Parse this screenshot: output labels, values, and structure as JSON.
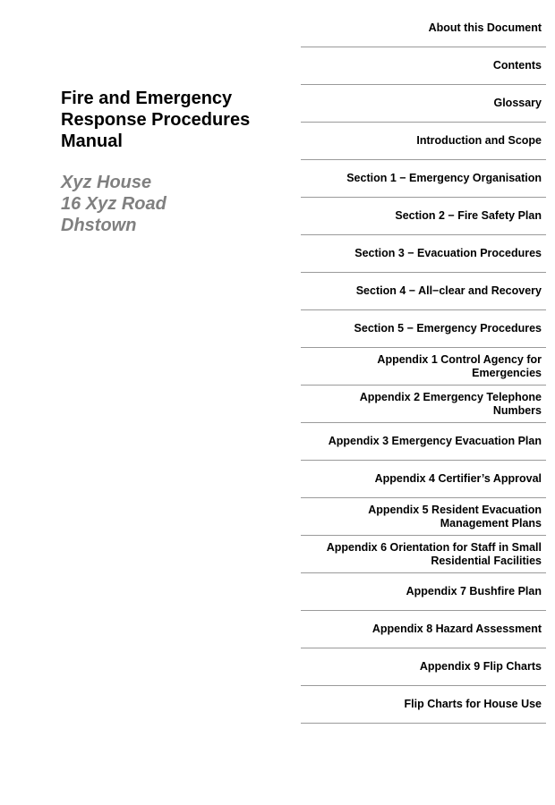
{
  "document": {
    "title_lines": [
      "Fire and Emergency",
      "Response Procedures",
      "Manual"
    ],
    "address_lines": [
      "Xyz House",
      "16 Xyz Road",
      "Dhstown"
    ]
  },
  "toc": {
    "items": [
      {
        "label": "About this Document"
      },
      {
        "label": "Contents"
      },
      {
        "label": "Glossary"
      },
      {
        "label": "Introduction and Scope"
      },
      {
        "label": "Section 1 − Emergency Organisation"
      },
      {
        "label": "Section 2 − Fire Safety Plan"
      },
      {
        "label": "Section 3 − Evacuation Procedures"
      },
      {
        "label": "Section 4 − All−clear and Recovery"
      },
      {
        "label": "Section 5 − Emergency Procedures"
      },
      {
        "label": "Appendix 1 Control Agency for\nEmergencies"
      },
      {
        "label": "Appendix 2  Emergency Telephone\nNumbers"
      },
      {
        "label": "Appendix 3  Emergency Evacuation Plan"
      },
      {
        "label": "Appendix 4  Certifier’s Approval"
      },
      {
        "label": "Appendix 5  Resident Evacuation\nManagement Plans"
      },
      {
        "label": "Appendix 6  Orientation for Staff in Small\nResidential Facilities"
      },
      {
        "label": "Appendix 7  Bushfire Plan"
      },
      {
        "label": "Appendix 8  Hazard Assessment"
      },
      {
        "label": "Appendix 9  Flip Charts"
      },
      {
        "label": "Flip Charts for House Use"
      }
    ]
  },
  "colors": {
    "title": "#000000",
    "address": "#808080",
    "divider": "#9a9a9a"
  }
}
